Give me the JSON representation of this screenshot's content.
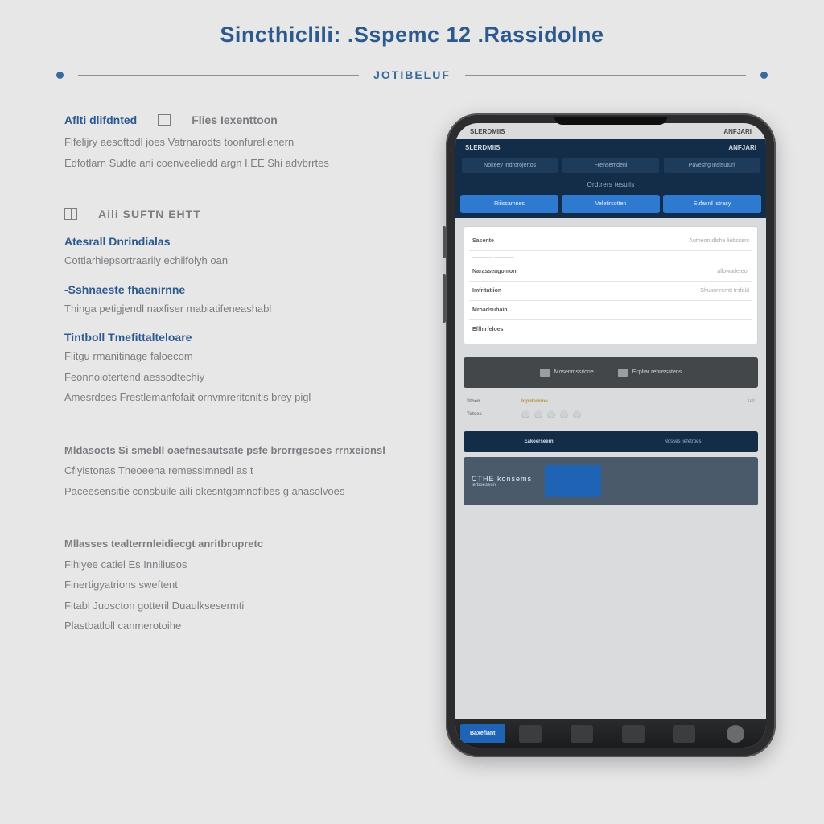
{
  "hero": {
    "title": "Sincthiclili: .Sspemc 12 .Rassidolne",
    "subtitle": "JOTIBELUF"
  },
  "features": {
    "block1": {
      "title_a": "Aflti dlifdnted",
      "title_b": "Flies Iexenttoon",
      "line1": "Flfelijry aesoftodl joes Vatrnarodts toonfurelienern",
      "line2": "Edfotlarn Sudte ani coenveeliedd argn I.EE Shi advbrrtes"
    },
    "block2": {
      "title": "Aili SUFTN EHTT",
      "sub1_h": "Atesrall Dnrindialas",
      "sub1_l": "Cottlarhiepsortraarily echilfolyh oan",
      "sub2_h": "-Sshnaeste fhaenirnne",
      "sub2_l": "Thinga petigjendl naxfiser mabiatifeneashabl",
      "sub3_h": "Tintboll Tmefittalteloare",
      "sub3_l1": "Flitgu rmanitinage faloecom",
      "sub3_l2": "Feonnoiotertend aessodtechiy",
      "sub3_l3": "Amesrdses Frestlemanfofait ornvmreritcnitls brey pigl"
    },
    "block3": {
      "head": "Mldasocts Si smebll oaefnesautsate psfe brorrgesoes rrnxeionsl",
      "line1": "Cfiyistonas Theoeena remessimnedl as t",
      "line2": "Paceesensitie consbuile aili okesntgamnofibes g anasolvoes"
    },
    "block4": {
      "head": "Mllasses tealterrnleidiecgt anritbrupretc",
      "l1": "Fihiyee catiel Es Inniliusos",
      "l2": "Finertigyatrions sweftent",
      "l3": "Fitabl Juoscton gotteril Duaulksesermti",
      "l4": "Plastbatloll canmerotoihe"
    }
  },
  "phone": {
    "status_left": "SLERDMIIS",
    "status_right": "ANFJARI",
    "header": {
      "top_left": "SLERDMIIS",
      "top_right": "ANFJARI",
      "cells": [
        "Nokeey Indrorojertos",
        "Frensemdeni",
        "Paveshg Insisuturi"
      ],
      "center": "Ordtrers tesulis"
    },
    "tabs": [
      "Riiissamnes",
      "Veletirsotten",
      "Eufasrd Istrasy"
    ],
    "form": {
      "row1": {
        "label": "Sasente",
        "val": "Autheorudlshe liebssers"
      },
      "sub": "",
      "row2": {
        "label": "Narasseagomon",
        "val": "allowadeteor"
      },
      "row3": {
        "label": "Imfritatiion",
        "val": "Shusonremtt trsfald"
      },
      "row4": {
        "label": "Mroadsubain",
        "val": ""
      },
      "row5": {
        "label": "Effhirfeloes",
        "val": ""
      }
    },
    "banner": {
      "a": "Mosenmssitone",
      "b": "Ecpliar  rebussatens"
    },
    "summary": {
      "r1": {
        "label": "Sthen",
        "val": "Iopoterione",
        "end": "itelt"
      },
      "r2": {
        "label": "Totees",
        "val": "",
        "end": ""
      }
    },
    "promo": {
      "a": "Eakoerseern",
      "b": "Nosses liefetroes",
      "title": "CTHE konsems",
      "sub": "terboesenn"
    },
    "tabbar": {
      "primary": "Baxeflant"
    }
  }
}
